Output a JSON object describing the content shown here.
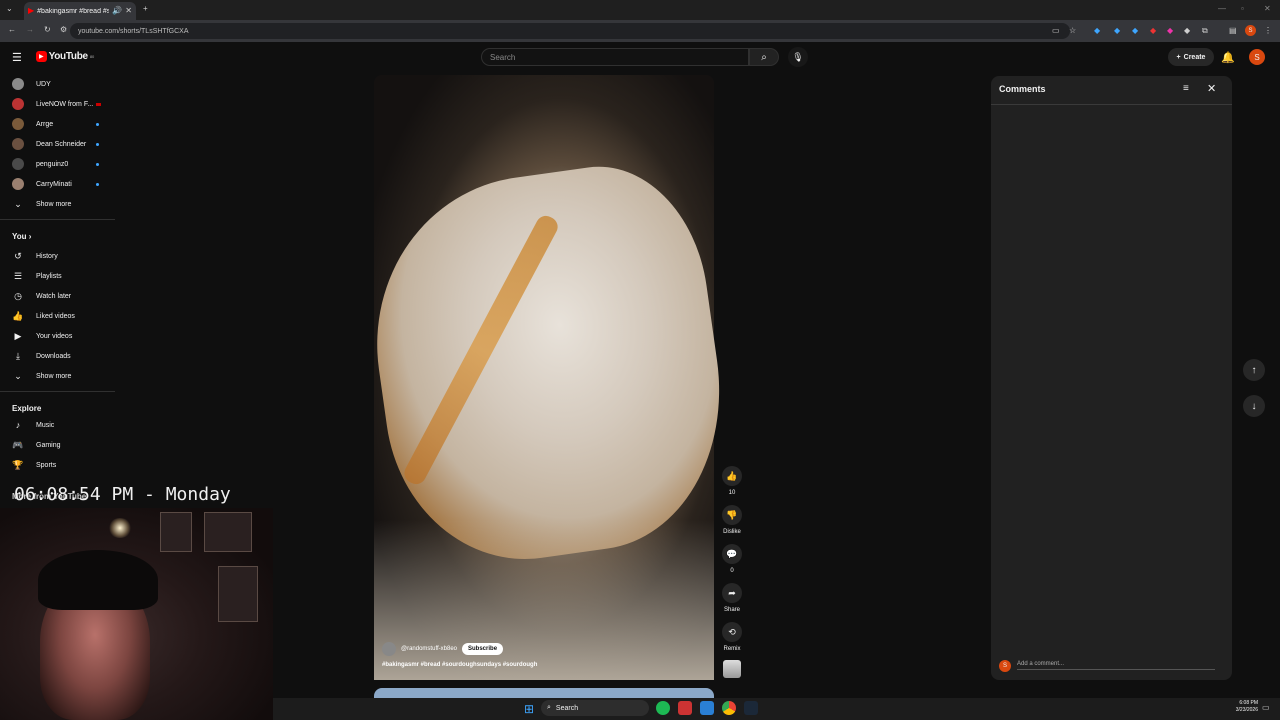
{
  "browser": {
    "tab_title": "#bakingasmr #bread #sour",
    "url": "youtube.com/shorts/TLsSHTfGCXA"
  },
  "header": {
    "logo": "YouTube",
    "logo_badge": "80",
    "search_placeholder": "Search",
    "create_label": "Create",
    "avatar_letter": "S"
  },
  "sidebar": {
    "subscriptions": [
      {
        "label": "UDY",
        "color": "#8a8a8a",
        "dot": false
      },
      {
        "label": "LiveNOW from F...",
        "color": "#b33",
        "dot": false
      },
      {
        "label": "Arrge",
        "color": "#7a5a3a",
        "dot": true
      },
      {
        "label": "Dean Schneider",
        "color": "#6a5040",
        "dot": true
      },
      {
        "label": "penguinz0",
        "color": "#4a4a4a",
        "dot": true
      },
      {
        "label": "CarryMinati",
        "color": "#9a8070",
        "dot": true
      }
    ],
    "show_more_1": "Show more",
    "you_heading": "You",
    "you_items": [
      {
        "label": "History",
        "icon": "↺"
      },
      {
        "label": "Playlists",
        "icon": "☰"
      },
      {
        "label": "Watch later",
        "icon": "◷"
      },
      {
        "label": "Liked videos",
        "icon": "👍"
      },
      {
        "label": "Your videos",
        "icon": "▶"
      },
      {
        "label": "Downloads",
        "icon": "⤓"
      }
    ],
    "show_more_2": "Show more",
    "explore_heading": "Explore",
    "explore_items": [
      {
        "label": "Music",
        "icon": "♪"
      },
      {
        "label": "Gaming",
        "icon": "🎮"
      },
      {
        "label": "Sports",
        "icon": "🏆"
      }
    ],
    "more_heading_partial": "More from YouTube"
  },
  "short": {
    "channel": "@randomstuff-xb8eo",
    "subscribe_label": "Subscribe",
    "caption": "#bakingasmr #bread #sourdoughsundays #sourdough",
    "likes": "10",
    "dislike_label": "Dislike",
    "comments_count": "0",
    "share_label": "Share",
    "remix_label": "Remix"
  },
  "comments": {
    "title": "Comments",
    "add_placeholder": "Add a comment...",
    "avatar_letter": "S"
  },
  "overlay": {
    "clock": "06:08:54 PM - Monday"
  },
  "taskbar": {
    "search_label": "Search",
    "time": "6:08 PM",
    "date": "3/23/2026"
  }
}
